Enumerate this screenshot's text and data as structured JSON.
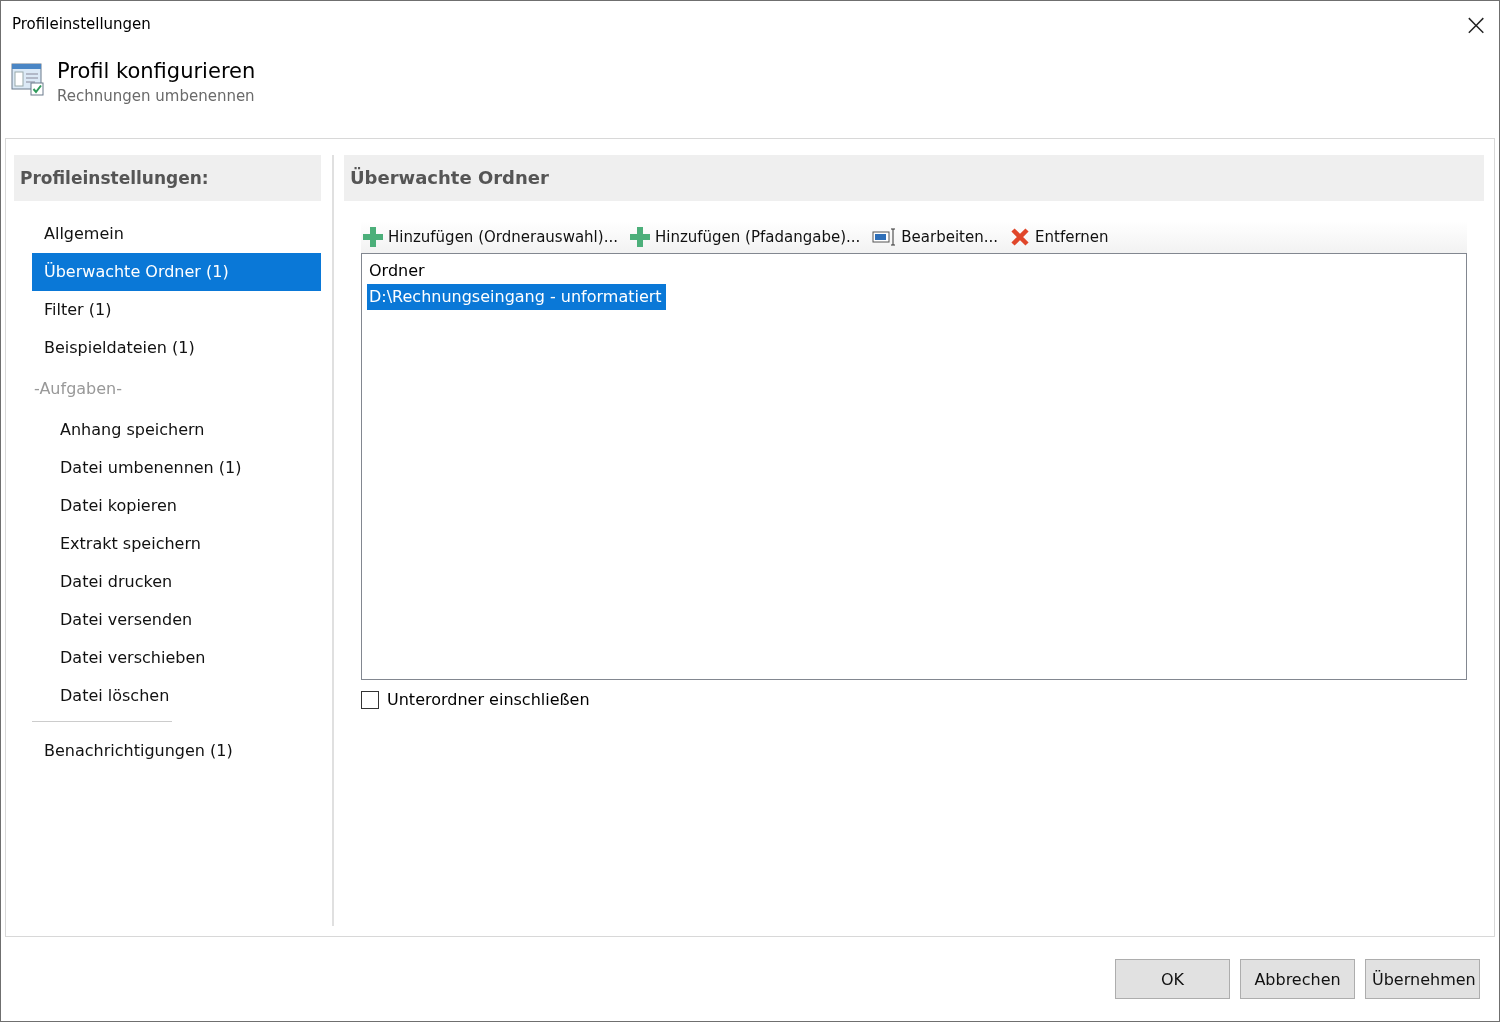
{
  "window": {
    "title": "Profileinstellungen",
    "close": "×"
  },
  "header": {
    "title": "Profil konfigurieren",
    "subtitle": "Rechnungen umbenennen"
  },
  "sidebar": {
    "title": "Profileinstellungen:",
    "items": [
      {
        "label": "Allgemein",
        "selected": false
      },
      {
        "label": "Überwachte Ordner (1)",
        "selected": true
      },
      {
        "label": "Filter (1)",
        "selected": false
      },
      {
        "label": "Beispieldateien (1)",
        "selected": false
      }
    ],
    "task_heading": "-Aufgaben-",
    "tasks": [
      {
        "label": "Anhang speichern",
        "selected": false
      },
      {
        "label": "Datei umbenennen (1)",
        "selected": false
      },
      {
        "label": "Datei kopieren",
        "selected": false
      },
      {
        "label": "Extrakt speichern",
        "selected": false
      },
      {
        "label": "Datei drucken",
        "selected": false
      },
      {
        "label": "Datei versenden",
        "selected": false
      },
      {
        "label": "Datei verschieben",
        "selected": false
      },
      {
        "label": "Datei löschen",
        "selected": false
      }
    ],
    "footer_items": [
      {
        "label": "Benachrichtigungen (1)",
        "selected": false
      }
    ]
  },
  "panel": {
    "title": "Überwachte Ordner",
    "toolbar": [
      {
        "kind": "add",
        "label": "Hinzufügen (Ordnerauswahl)..."
      },
      {
        "kind": "add",
        "label": "Hinzufügen (Pfadangabe)..."
      },
      {
        "kind": "edit",
        "label": "Bearbeiten..."
      },
      {
        "kind": "remove",
        "label": "Entfernen"
      }
    ],
    "table": {
      "columns": [
        "Ordner"
      ],
      "rows": [
        {
          "text": "D:\\Rechnungseingang - unformatiert",
          "selected": true
        }
      ]
    },
    "checkbox": {
      "label": "Unterordner einschließen",
      "checked": false
    }
  },
  "buttons": [
    "OK",
    "Abbrechen",
    "Übernehmen"
  ]
}
